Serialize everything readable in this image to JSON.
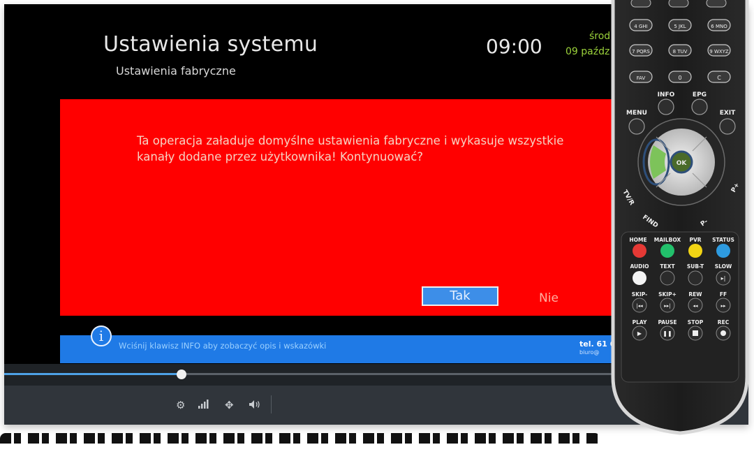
{
  "tv": {
    "title": "Ustawienia systemu",
    "subtitle": "Ustawienia fabryczne",
    "clock": "09:00",
    "day_partial": "środ",
    "date_partial": "09 paźdz",
    "dialog": {
      "message": "Ta operacja załaduje domyślne ustawienia fabryczne i wykasuje wszystkie kanały dodane przez użytkownika! Kontynuować?",
      "yes_label": "Tak",
      "no_label": "Nie",
      "selected": "yes"
    },
    "info_bar": {
      "icon": "info-icon",
      "hint": "Wciśnij klawisz INFO aby zobaczyć opis i wskazówki",
      "phone_partial": "tel. 61 6",
      "email_partial": "biuro@"
    },
    "colors": {
      "dialog": "#ff0000",
      "info_bar": "#1f7ae6",
      "selected_button": "#3d8ee8"
    }
  },
  "player": {
    "progress": 0.238,
    "controls": [
      {
        "icon": "settings-icon",
        "glyph": "⚙"
      },
      {
        "icon": "signal-icon",
        "glyph": ""
      },
      {
        "icon": "move-icon",
        "glyph": "✥"
      },
      {
        "icon": "volume-icon",
        "glyph": "🔈"
      }
    ]
  },
  "remote": {
    "number_row_keys": [
      "4 GHI",
      "5 JKL",
      "6 MNO",
      "7 PQRS",
      "8 TUV",
      "9 WXYZ"
    ],
    "special_keys": [
      "FAV",
      "0",
      "C"
    ],
    "nav_labels": {
      "info": "INFO",
      "epg": "EPG",
      "menu": "MENU",
      "exit": "EXIT",
      "ok": "OK",
      "tv_r": "TV/R",
      "find": "FIND",
      "p_plus": "P+",
      "p_minus": "P-"
    },
    "color_row_labels": [
      "HOME",
      "MAILBOX",
      "PVR",
      "STATUS"
    ],
    "color_row_colors": [
      "#e53935",
      "#22c06b",
      "#f2d414",
      "#2e9be0"
    ],
    "row2_labels": [
      "AUDIO",
      "TEXT",
      "SUB-T",
      "SLOW"
    ],
    "row3_labels": [
      "SKIP-",
      "SKIP+",
      "REW",
      "FF"
    ],
    "row4_labels": [
      "PLAY",
      "PAUSE",
      "STOP",
      "REC"
    ],
    "highlight_color": "#7dc35a"
  }
}
